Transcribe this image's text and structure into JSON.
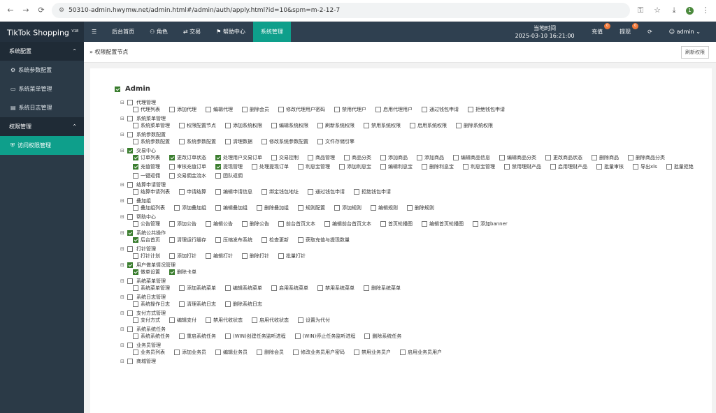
{
  "browser": {
    "url": "50310-admin.hwymw.net/admin.html#/admin/auth/apply.html?id=10&spm=m-2-12-7",
    "ext_badge": "1"
  },
  "topbar": {
    "brand": "TikTok Shopping",
    "brand_ver": "V18",
    "menu": [
      "☰",
      "后台首页",
      "角色",
      "交易",
      "帮助中心",
      "系统管理"
    ],
    "clock_label": "当地时间",
    "clock_time": "2025-03-10 16:21:00",
    "recharge": "充值",
    "recharge_badge": "0",
    "withdraw": "提现",
    "withdraw_badge": "0",
    "user": "admin"
  },
  "sidebar": {
    "g1": "系统配置",
    "i1": "系统参数配置",
    "i2": "系统菜单管理",
    "i3": "系统日志管理",
    "g2": "权限管理",
    "i4": "访问权限管理"
  },
  "crumb": "权限配置节点",
  "refresh": "刷新权限",
  "root": "Admin",
  "tree": [
    {
      "title": "代理管理",
      "on": false,
      "items": [
        {
          "t": "代理列表",
          "on": false
        },
        {
          "t": "添加代理",
          "on": false
        },
        {
          "t": "编辑代理",
          "on": false
        },
        {
          "t": "删除会员",
          "on": false
        },
        {
          "t": "修改代理用户密码",
          "on": false
        },
        {
          "t": "禁用代理户",
          "on": false
        },
        {
          "t": "启用代理用户",
          "on": false
        },
        {
          "t": "通过钱包申请",
          "on": false
        },
        {
          "t": "拒绝钱包申请",
          "on": false
        }
      ]
    },
    {
      "title": "系统菜单管理",
      "on": false,
      "items": [
        {
          "t": "系统菜单管理",
          "on": false
        },
        {
          "t": "权限配置节点",
          "on": false
        },
        {
          "t": "添加系统权限",
          "on": false
        },
        {
          "t": "编辑系统权限",
          "on": false
        },
        {
          "t": "刷新系统权限",
          "on": false
        },
        {
          "t": "禁用系统权限",
          "on": false
        },
        {
          "t": "启用系统权限",
          "on": false
        },
        {
          "t": "删除系统权限",
          "on": false
        }
      ]
    },
    {
      "title": "系统参数配置",
      "on": false,
      "items": [
        {
          "t": "系统参数配置",
          "on": false
        },
        {
          "t": "系统参数配置",
          "on": false
        },
        {
          "t": "清理数据",
          "on": false
        },
        {
          "t": "修改系统参数配置",
          "on": false
        },
        {
          "t": "文件存储引擎",
          "on": false
        }
      ]
    },
    {
      "title": "交易中心",
      "on": true,
      "items": [
        {
          "t": "订单列表",
          "on": true
        },
        {
          "t": "更改订单状态",
          "on": true
        },
        {
          "t": "处理用户交易订单",
          "on": true
        },
        {
          "t": "交易控制",
          "on": false
        },
        {
          "t": "商品管理",
          "on": false
        },
        {
          "t": "商品分类",
          "on": false
        },
        {
          "t": "添加商品",
          "on": false
        },
        {
          "t": "添加商品",
          "on": false
        },
        {
          "t": "编辑商品信息",
          "on": false
        },
        {
          "t": "编辑商品分类",
          "on": false
        },
        {
          "t": "更改商品状态",
          "on": false
        },
        {
          "t": "删除商品",
          "on": false
        },
        {
          "t": "删除商品分类",
          "on": false
        },
        {
          "t": "充值管理",
          "on": true
        },
        {
          "t": "审核充值订单",
          "on": false
        },
        {
          "t": "提现管理",
          "on": true
        },
        {
          "t": "处理提现订单",
          "on": false
        },
        {
          "t": "利息宝管理",
          "on": false
        },
        {
          "t": "添加利息宝",
          "on": false
        },
        {
          "t": "编辑利息宝",
          "on": false
        },
        {
          "t": "删除利息宝",
          "on": false
        },
        {
          "t": "利息宝管理",
          "on": false
        },
        {
          "t": "禁用理财产品",
          "on": false
        },
        {
          "t": "启用理财产品",
          "on": false
        },
        {
          "t": "批量审核",
          "on": false
        },
        {
          "t": "导出xls",
          "on": false
        },
        {
          "t": "批量拒绝",
          "on": false
        },
        {
          "t": "一键返佣",
          "on": false
        },
        {
          "t": "交易佣金流水",
          "on": false
        },
        {
          "t": "团队返佣",
          "on": false
        }
      ]
    },
    {
      "title": "结算申请管理",
      "on": false,
      "items": [
        {
          "t": "结算申请列表",
          "on": false
        },
        {
          "t": "申请结算",
          "on": false
        },
        {
          "t": "编辑申请信息",
          "on": false
        },
        {
          "t": "绑定钱包地址",
          "on": false
        },
        {
          "t": "通过钱包申请",
          "on": false
        },
        {
          "t": "拒绝钱包申请",
          "on": false
        }
      ]
    },
    {
      "title": "叠加组",
      "on": false,
      "items": [
        {
          "t": "叠加组列表",
          "on": false
        },
        {
          "t": "添加叠加组",
          "on": false
        },
        {
          "t": "编辑叠加组",
          "on": false
        },
        {
          "t": "删除叠加组",
          "on": false
        },
        {
          "t": "规则配置",
          "on": false
        },
        {
          "t": "添加规则",
          "on": false
        },
        {
          "t": "编辑规则",
          "on": false
        },
        {
          "t": "删除规则",
          "on": false
        }
      ]
    },
    {
      "title": "帮助中心",
      "on": false,
      "items": [
        {
          "t": "公告管理",
          "on": false
        },
        {
          "t": "添加公告",
          "on": false
        },
        {
          "t": "编辑公告",
          "on": false
        },
        {
          "t": "删除公告",
          "on": false
        },
        {
          "t": "前台首页文本",
          "on": false
        },
        {
          "t": "编辑前台首页文本",
          "on": false
        },
        {
          "t": "首页轮播图",
          "on": false
        },
        {
          "t": "编辑首页轮播图",
          "on": false
        },
        {
          "t": "添加banner",
          "on": false
        }
      ]
    },
    {
      "title": "系统公共操作",
      "on": true,
      "items": [
        {
          "t": "后台首页",
          "on": true
        },
        {
          "t": "清理运行缓存",
          "on": false
        },
        {
          "t": "压缩发布系统",
          "on": false
        },
        {
          "t": "检查更新",
          "on": false
        },
        {
          "t": "获取充值与提现数量",
          "on": false
        }
      ]
    },
    {
      "title": "打针管理",
      "on": false,
      "items": [
        {
          "t": "打针计划",
          "on": false
        },
        {
          "t": "添加打针",
          "on": false
        },
        {
          "t": "编辑打针",
          "on": false
        },
        {
          "t": "删除打针",
          "on": false
        },
        {
          "t": "批量打针",
          "on": false
        }
      ]
    },
    {
      "title": "用户做单情况管理",
      "on": true,
      "items": [
        {
          "t": "做单设置",
          "on": true
        },
        {
          "t": "删除卡单",
          "on": true
        }
      ]
    },
    {
      "title": "系统菜单管理",
      "on": false,
      "items": [
        {
          "t": "系统菜单管理",
          "on": false
        },
        {
          "t": "添加系统菜单",
          "on": false
        },
        {
          "t": "编辑系统菜单",
          "on": false
        },
        {
          "t": "启用系统菜单",
          "on": false
        },
        {
          "t": "禁用系统菜单",
          "on": false
        },
        {
          "t": "删除系统菜单",
          "on": false
        }
      ]
    },
    {
      "title": "系统日志管理",
      "on": false,
      "items": [
        {
          "t": "系统操作日志",
          "on": false
        },
        {
          "t": "清理系统日志",
          "on": false
        },
        {
          "t": "删除系统日志",
          "on": false
        }
      ]
    },
    {
      "title": "支付方式管理",
      "on": false,
      "items": [
        {
          "t": "支付方式",
          "on": false
        },
        {
          "t": "编辑支付",
          "on": false
        },
        {
          "t": "禁用代收状态",
          "on": false
        },
        {
          "t": "启用代收状态",
          "on": false
        },
        {
          "t": "设置为代付",
          "on": false
        }
      ]
    },
    {
      "title": "系统系统任务",
      "on": false,
      "items": [
        {
          "t": "系统系统任务",
          "on": false
        },
        {
          "t": "重启系统任务",
          "on": false
        },
        {
          "t": "(WIN)创建任务监听进程",
          "on": false
        },
        {
          "t": "(WIN)停止任务监听进程",
          "on": false
        },
        {
          "t": "删除系统任务",
          "on": false
        }
      ]
    },
    {
      "title": "业务员管理",
      "on": false,
      "items": [
        {
          "t": "业务员列表",
          "on": false
        },
        {
          "t": "添加业务员",
          "on": false
        },
        {
          "t": "编辑业务员",
          "on": false
        },
        {
          "t": "删除会员",
          "on": false
        },
        {
          "t": "修改业务员用户密码",
          "on": false
        },
        {
          "t": "禁用业务员户",
          "on": false
        },
        {
          "t": "启用业务员用户",
          "on": false
        }
      ]
    },
    {
      "title": "商城管理",
      "on": false,
      "items": []
    }
  ]
}
